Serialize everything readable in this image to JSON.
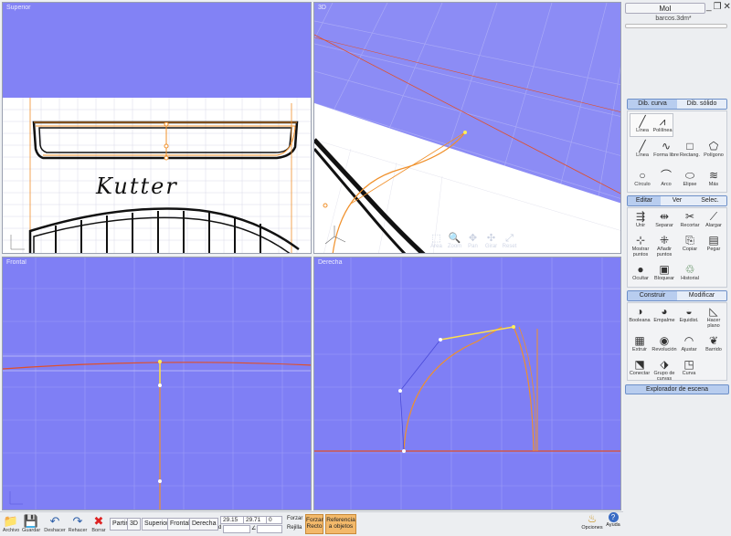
{
  "viewports": {
    "top": {
      "title": "Superior",
      "label": "Kutter"
    },
    "three_d": {
      "title": "3D"
    },
    "front": {
      "title": "Frontal"
    },
    "right": {
      "title": "Derecha"
    }
  },
  "nav_tools": [
    {
      "icon": "pan-icon",
      "glyph": "⬚",
      "label": "Área"
    },
    {
      "icon": "zoom-icon",
      "glyph": "🔍",
      "label": "Zoom"
    },
    {
      "icon": "move-icon",
      "glyph": "✥",
      "label": "Pan"
    },
    {
      "icon": "orbit-icon",
      "glyph": "✣",
      "label": "Girar"
    },
    {
      "icon": "reset-icon",
      "glyph": "⤢",
      "label": "Reset"
    }
  ],
  "app": {
    "title": "MoI",
    "filename": "barcos.3dm*",
    "window_buttons": [
      "_",
      "❐",
      "✕"
    ]
  },
  "draw_tabs": {
    "curve": "Dib. curva",
    "solid": "Dib. sólido"
  },
  "curve_tools_row1": [
    {
      "label": "Línea",
      "glyph": "╱"
    },
    {
      "label": "Polilínea",
      "glyph": "⩘"
    }
  ],
  "curve_tools": [
    {
      "label": "Línea",
      "glyph": "╱"
    },
    {
      "label": "Forma libre",
      "glyph": "∿"
    },
    {
      "label": "Rectang.",
      "glyph": "□"
    },
    {
      "label": "Polígono",
      "glyph": "⬠"
    },
    {
      "label": "Círculo",
      "glyph": "○"
    },
    {
      "label": "Arco",
      "glyph": "⌒"
    },
    {
      "label": "Elipse",
      "glyph": "⬭"
    },
    {
      "label": "Más",
      "glyph": "≋"
    }
  ],
  "edit_tabs": {
    "edit": "Editar",
    "view": "Ver",
    "select": "Selec."
  },
  "edit_tools": [
    {
      "label": "Unir",
      "glyph": "⇶"
    },
    {
      "label": "Separar",
      "glyph": "⇹"
    },
    {
      "label": "Recortar",
      "glyph": "✂"
    },
    {
      "label": "Alargar",
      "glyph": "⟋"
    },
    {
      "label": "Mostrar puntos",
      "glyph": "⊹"
    },
    {
      "label": "Añadir puntos",
      "glyph": "⁜"
    },
    {
      "label": "Copiar",
      "glyph": "⎘"
    },
    {
      "label": "Pegar",
      "glyph": "▤"
    },
    {
      "label": "Ocultar",
      "glyph": "●"
    },
    {
      "label": "Bloquear",
      "glyph": "▣"
    },
    {
      "label": "Historial",
      "glyph": "♲"
    }
  ],
  "build_tabs": {
    "build": "Construir",
    "modify": "Modificar"
  },
  "build_tools": [
    {
      "label": "Booleana",
      "glyph": "◑"
    },
    {
      "label": "Empalme",
      "glyph": "◕"
    },
    {
      "label": "Equidist.",
      "glyph": "◒"
    },
    {
      "label": "Hacer plano",
      "glyph": "◺"
    },
    {
      "label": "Extruir",
      "glyph": "▦"
    },
    {
      "label": "Revolución",
      "glyph": "◉"
    },
    {
      "label": "Ajustar",
      "glyph": "◠"
    },
    {
      "label": "Barrido",
      "glyph": "❦"
    },
    {
      "label": "Conectar",
      "glyph": "⬔"
    },
    {
      "label": "Grupo de curvas",
      "glyph": "⬗"
    },
    {
      "label": "Curva",
      "glyph": "◳"
    }
  ],
  "scene_explorer": "Explorador de escena",
  "bottom": {
    "file_buttons": [
      {
        "label": "Archivo",
        "glyph": "📁"
      },
      {
        "label": "Guardar",
        "glyph": "💾"
      },
      {
        "label": "Deshacer",
        "glyph": "↶"
      },
      {
        "label": "Rehacer",
        "glyph": "↷"
      },
      {
        "label": "Borrar",
        "glyph": "✖"
      }
    ],
    "views": [
      "Partir",
      "3D",
      "Superior",
      "Frontal",
      "Derecha"
    ],
    "coords": {
      "x": "29.15",
      "y": "29.71",
      "z": "0",
      "d_label": "d",
      "a_label": "∠"
    },
    "snap_labels": {
      "force": "Forzar",
      "grid": "Rejilla"
    },
    "force_straight": "Forzar Recto",
    "object_snap": "Referencia a objetos",
    "options": "Opciones",
    "help": "Ayuda"
  },
  "colors": {
    "viewport_bg": "#7f7ff5",
    "curve": "#f0902a",
    "construction": "#e0502a",
    "accent_tab": "#b8cdef"
  }
}
